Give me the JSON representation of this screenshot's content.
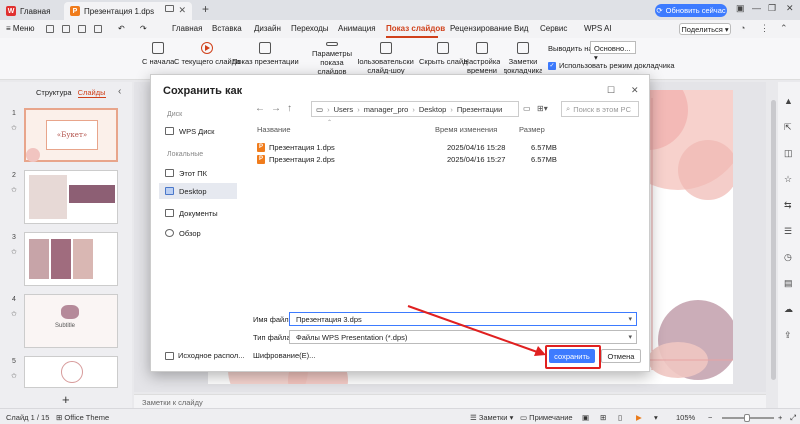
{
  "titlebar": {
    "home_tab": "Главная",
    "doc_tab": "Презентация 1.dps",
    "update_button": "Обновить сейчас"
  },
  "menubar": {
    "menu_label": "Меню",
    "tabs": [
      "Главная",
      "Вставка",
      "Дизайн",
      "Переходы",
      "Анимация",
      "Показ слайдов",
      "Рецензирование",
      "Вид",
      "Сервис",
      "WPS AI"
    ],
    "active_tab": "Показ слайдов",
    "share_button": "Поделиться"
  },
  "ribbon": {
    "buttons": [
      "С начала",
      "С текущего слайда",
      "Показ презентации",
      "Параметры показа слайдов",
      "Пользовательские слайд-шоу",
      "Скрыть слайд",
      "Настройка времени",
      "Заметки докладчика"
    ],
    "output_label": "Выводить на:",
    "output_value": "Основно...",
    "presenter_mode": "Использовать режим докладчика"
  },
  "left_panel": {
    "tab_structure": "Структура",
    "tab_slides": "Слайды",
    "slide_numbers": [
      "1",
      "2",
      "3",
      "4",
      "5"
    ],
    "slide1_title": "«Букет»",
    "slide4_label": "Subtitle"
  },
  "notes_placeholder": "Заметки к слайду",
  "statusbar": {
    "slide_info": "Слайд 1 / 15",
    "theme": "Office Theme",
    "notes": "Заметки",
    "comment": "Примечание",
    "zoom": "105%"
  },
  "dialog": {
    "title": "Сохранить как",
    "section_disk": "Диск",
    "wps_disk": "WPS Диск",
    "section_local": "Локальные",
    "locations": [
      "Этот ПК",
      "Desktop",
      "Документы",
      "Обзор"
    ],
    "selected_location": "Desktop",
    "path": [
      "Users",
      "manager_pro",
      "Desktop",
      "Презентации"
    ],
    "search_placeholder": "Поиск в этом PC",
    "columns": {
      "name": "Название",
      "modified": "Время изменения",
      "size": "Размер"
    },
    "files": [
      {
        "name": "Презентация 1.dps",
        "modified": "2025/04/16 15:28",
        "size": "6.57MB"
      },
      {
        "name": "Презентация 2.dps",
        "modified": "2025/04/16 15:27",
        "size": "6.57MB"
      }
    ],
    "filename_label": "Имя файла:",
    "filename_value": "Презентация 3.dps",
    "filetype_label": "Тип файла:",
    "filetype_value": "Файлы WPS Presentation (*.dps)",
    "encrypt_label": "Шифрование(E)...",
    "source_location": "Исходное распол...",
    "save_button": "сохранить",
    "cancel_button": "Отмена"
  },
  "colors": {
    "accent": "#d0411b",
    "primary_button": "#3d7bff",
    "highlight": "#e02020"
  }
}
